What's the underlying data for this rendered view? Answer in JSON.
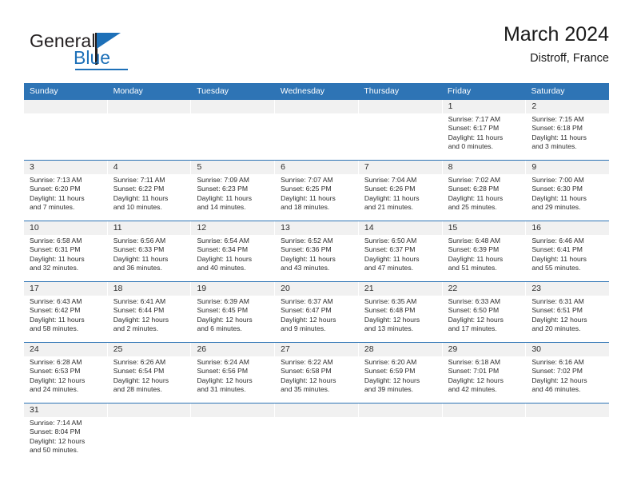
{
  "brand": {
    "name_part1": "General",
    "name_part2": "Blue",
    "triangle_icon": "triangle-icon",
    "accent_color": "#1d70b8"
  },
  "header": {
    "title": "March 2024",
    "subtitle": "Distroff, France"
  },
  "theme": {
    "header_row_bg": "#2e74b5",
    "day_band_bg": "#f1f1f1",
    "row_rule": "#2e74b5",
    "text": "#2b2b2b"
  },
  "calendar": {
    "weekday_headers": [
      "Sunday",
      "Monday",
      "Tuesday",
      "Wednesday",
      "Thursday",
      "Friday",
      "Saturday"
    ],
    "weeks": [
      [
        {
          "day": "",
          "lines": []
        },
        {
          "day": "",
          "lines": []
        },
        {
          "day": "",
          "lines": []
        },
        {
          "day": "",
          "lines": []
        },
        {
          "day": "",
          "lines": []
        },
        {
          "day": "1",
          "lines": [
            "Sunrise: 7:17 AM",
            "Sunset: 6:17 PM",
            "Daylight: 11 hours",
            "and 0 minutes."
          ]
        },
        {
          "day": "2",
          "lines": [
            "Sunrise: 7:15 AM",
            "Sunset: 6:18 PM",
            "Daylight: 11 hours",
            "and 3 minutes."
          ]
        }
      ],
      [
        {
          "day": "3",
          "lines": [
            "Sunrise: 7:13 AM",
            "Sunset: 6:20 PM",
            "Daylight: 11 hours",
            "and 7 minutes."
          ]
        },
        {
          "day": "4",
          "lines": [
            "Sunrise: 7:11 AM",
            "Sunset: 6:22 PM",
            "Daylight: 11 hours",
            "and 10 minutes."
          ]
        },
        {
          "day": "5",
          "lines": [
            "Sunrise: 7:09 AM",
            "Sunset: 6:23 PM",
            "Daylight: 11 hours",
            "and 14 minutes."
          ]
        },
        {
          "day": "6",
          "lines": [
            "Sunrise: 7:07 AM",
            "Sunset: 6:25 PM",
            "Daylight: 11 hours",
            "and 18 minutes."
          ]
        },
        {
          "day": "7",
          "lines": [
            "Sunrise: 7:04 AM",
            "Sunset: 6:26 PM",
            "Daylight: 11 hours",
            "and 21 minutes."
          ]
        },
        {
          "day": "8",
          "lines": [
            "Sunrise: 7:02 AM",
            "Sunset: 6:28 PM",
            "Daylight: 11 hours",
            "and 25 minutes."
          ]
        },
        {
          "day": "9",
          "lines": [
            "Sunrise: 7:00 AM",
            "Sunset: 6:30 PM",
            "Daylight: 11 hours",
            "and 29 minutes."
          ]
        }
      ],
      [
        {
          "day": "10",
          "lines": [
            "Sunrise: 6:58 AM",
            "Sunset: 6:31 PM",
            "Daylight: 11 hours",
            "and 32 minutes."
          ]
        },
        {
          "day": "11",
          "lines": [
            "Sunrise: 6:56 AM",
            "Sunset: 6:33 PM",
            "Daylight: 11 hours",
            "and 36 minutes."
          ]
        },
        {
          "day": "12",
          "lines": [
            "Sunrise: 6:54 AM",
            "Sunset: 6:34 PM",
            "Daylight: 11 hours",
            "and 40 minutes."
          ]
        },
        {
          "day": "13",
          "lines": [
            "Sunrise: 6:52 AM",
            "Sunset: 6:36 PM",
            "Daylight: 11 hours",
            "and 43 minutes."
          ]
        },
        {
          "day": "14",
          "lines": [
            "Sunrise: 6:50 AM",
            "Sunset: 6:37 PM",
            "Daylight: 11 hours",
            "and 47 minutes."
          ]
        },
        {
          "day": "15",
          "lines": [
            "Sunrise: 6:48 AM",
            "Sunset: 6:39 PM",
            "Daylight: 11 hours",
            "and 51 minutes."
          ]
        },
        {
          "day": "16",
          "lines": [
            "Sunrise: 6:46 AM",
            "Sunset: 6:41 PM",
            "Daylight: 11 hours",
            "and 55 minutes."
          ]
        }
      ],
      [
        {
          "day": "17",
          "lines": [
            "Sunrise: 6:43 AM",
            "Sunset: 6:42 PM",
            "Daylight: 11 hours",
            "and 58 minutes."
          ]
        },
        {
          "day": "18",
          "lines": [
            "Sunrise: 6:41 AM",
            "Sunset: 6:44 PM",
            "Daylight: 12 hours",
            "and 2 minutes."
          ]
        },
        {
          "day": "19",
          "lines": [
            "Sunrise: 6:39 AM",
            "Sunset: 6:45 PM",
            "Daylight: 12 hours",
            "and 6 minutes."
          ]
        },
        {
          "day": "20",
          "lines": [
            "Sunrise: 6:37 AM",
            "Sunset: 6:47 PM",
            "Daylight: 12 hours",
            "and 9 minutes."
          ]
        },
        {
          "day": "21",
          "lines": [
            "Sunrise: 6:35 AM",
            "Sunset: 6:48 PM",
            "Daylight: 12 hours",
            "and 13 minutes."
          ]
        },
        {
          "day": "22",
          "lines": [
            "Sunrise: 6:33 AM",
            "Sunset: 6:50 PM",
            "Daylight: 12 hours",
            "and 17 minutes."
          ]
        },
        {
          "day": "23",
          "lines": [
            "Sunrise: 6:31 AM",
            "Sunset: 6:51 PM",
            "Daylight: 12 hours",
            "and 20 minutes."
          ]
        }
      ],
      [
        {
          "day": "24",
          "lines": [
            "Sunrise: 6:28 AM",
            "Sunset: 6:53 PM",
            "Daylight: 12 hours",
            "and 24 minutes."
          ]
        },
        {
          "day": "25",
          "lines": [
            "Sunrise: 6:26 AM",
            "Sunset: 6:54 PM",
            "Daylight: 12 hours",
            "and 28 minutes."
          ]
        },
        {
          "day": "26",
          "lines": [
            "Sunrise: 6:24 AM",
            "Sunset: 6:56 PM",
            "Daylight: 12 hours",
            "and 31 minutes."
          ]
        },
        {
          "day": "27",
          "lines": [
            "Sunrise: 6:22 AM",
            "Sunset: 6:58 PM",
            "Daylight: 12 hours",
            "and 35 minutes."
          ]
        },
        {
          "day": "28",
          "lines": [
            "Sunrise: 6:20 AM",
            "Sunset: 6:59 PM",
            "Daylight: 12 hours",
            "and 39 minutes."
          ]
        },
        {
          "day": "29",
          "lines": [
            "Sunrise: 6:18 AM",
            "Sunset: 7:01 PM",
            "Daylight: 12 hours",
            "and 42 minutes."
          ]
        },
        {
          "day": "30",
          "lines": [
            "Sunrise: 6:16 AM",
            "Sunset: 7:02 PM",
            "Daylight: 12 hours",
            "and 46 minutes."
          ]
        }
      ],
      [
        {
          "day": "31",
          "lines": [
            "Sunrise: 7:14 AM",
            "Sunset: 8:04 PM",
            "Daylight: 12 hours",
            "and 50 minutes."
          ]
        },
        {
          "day": "",
          "lines": []
        },
        {
          "day": "",
          "lines": []
        },
        {
          "day": "",
          "lines": []
        },
        {
          "day": "",
          "lines": []
        },
        {
          "day": "",
          "lines": []
        },
        {
          "day": "",
          "lines": []
        }
      ]
    ]
  }
}
